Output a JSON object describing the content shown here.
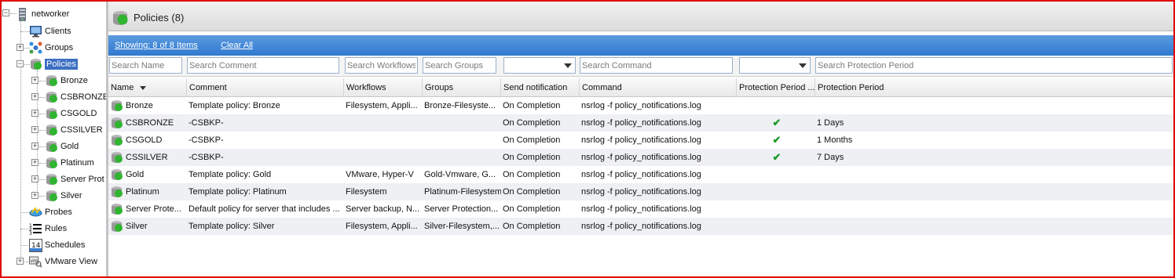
{
  "tree": {
    "root": "networker",
    "items": [
      {
        "label": "Clients",
        "icon": "monitor-icon"
      },
      {
        "label": "Groups",
        "icon": "groups-icon"
      },
      {
        "label": "Policies",
        "icon": "policy-icon",
        "selected": true
      },
      {
        "label": "Probes",
        "icon": "probe-icon"
      },
      {
        "label": "Rules",
        "icon": "rules-icon"
      },
      {
        "label": "Schedules",
        "icon": "calendar-icon",
        "badge": "14"
      },
      {
        "label": "VMware View",
        "icon": "vmware-icon",
        "badge": "vm"
      }
    ],
    "policies": [
      "Bronze",
      "CSBRONZE",
      "CSGOLD",
      "CSSILVER",
      "Gold",
      "Platinum",
      "Server Prot",
      "Silver"
    ]
  },
  "header": {
    "title": "Policies (8)"
  },
  "toolbar": {
    "showing": "Showing: 8 of 8 Items",
    "clear_all": "Clear All"
  },
  "filters": {
    "name": "Search Name",
    "comment": "Search Comment",
    "workflows": "Search Workflows",
    "groups": "Search Groups",
    "command": "Search Command",
    "protection_period": "Search Protection Period"
  },
  "table": {
    "columns": [
      "Name",
      "Comment",
      "Workflows",
      "Groups",
      "Send notification",
      "Command",
      "Protection Period ...",
      "Protection Period"
    ],
    "rows": [
      {
        "name": "Bronze",
        "comment": "Template policy: Bronze",
        "workflows": "Filesystem, Appli...",
        "groups": "Bronze-Filesyste...",
        "notify": "On Completion",
        "command": "nsrlog -f policy_notifications.log",
        "check": false,
        "period": ""
      },
      {
        "name": "CSBRONZE",
        "comment": "-CSBKP-",
        "workflows": "",
        "groups": "",
        "notify": "On Completion",
        "command": "nsrlog -f policy_notifications.log",
        "check": true,
        "period": "1 Days"
      },
      {
        "name": "CSGOLD",
        "comment": "-CSBKP-",
        "workflows": "",
        "groups": "",
        "notify": "On Completion",
        "command": "nsrlog -f policy_notifications.log",
        "check": true,
        "period": "1 Months"
      },
      {
        "name": "CSSILVER",
        "comment": "-CSBKP-",
        "workflows": "",
        "groups": "",
        "notify": "On Completion",
        "command": "nsrlog -f policy_notifications.log",
        "check": true,
        "period": "7 Days"
      },
      {
        "name": "Gold",
        "comment": "Template policy: Gold",
        "workflows": "VMware, Hyper-V",
        "groups": "Gold-Vmware, G...",
        "notify": "On Completion",
        "command": "nsrlog -f policy_notifications.log",
        "check": false,
        "period": ""
      },
      {
        "name": "Platinum",
        "comment": "Template policy: Platinum",
        "workflows": "Filesystem",
        "groups": "Platinum-Filesystem",
        "notify": "On Completion",
        "command": "nsrlog -f policy_notifications.log",
        "check": false,
        "period": ""
      },
      {
        "name": "Server Prote...",
        "comment": "Default policy for server that includes ...",
        "workflows": "Server backup, N...",
        "groups": "Server Protection...",
        "notify": "On Completion",
        "command": "nsrlog -f policy_notifications.log",
        "check": false,
        "period": ""
      },
      {
        "name": "Silver",
        "comment": "Template policy: Silver",
        "workflows": "Filesystem, Appli...",
        "groups": "Silver-Filesystem,...",
        "notify": "On Completion",
        "command": "nsrlog -f policy_notifications.log",
        "check": false,
        "period": ""
      }
    ]
  },
  "colors": {
    "accent": "#2f79cf",
    "selection": "#3b6fc2",
    "check": "#1f9a2a",
    "frame": "#e00000"
  }
}
